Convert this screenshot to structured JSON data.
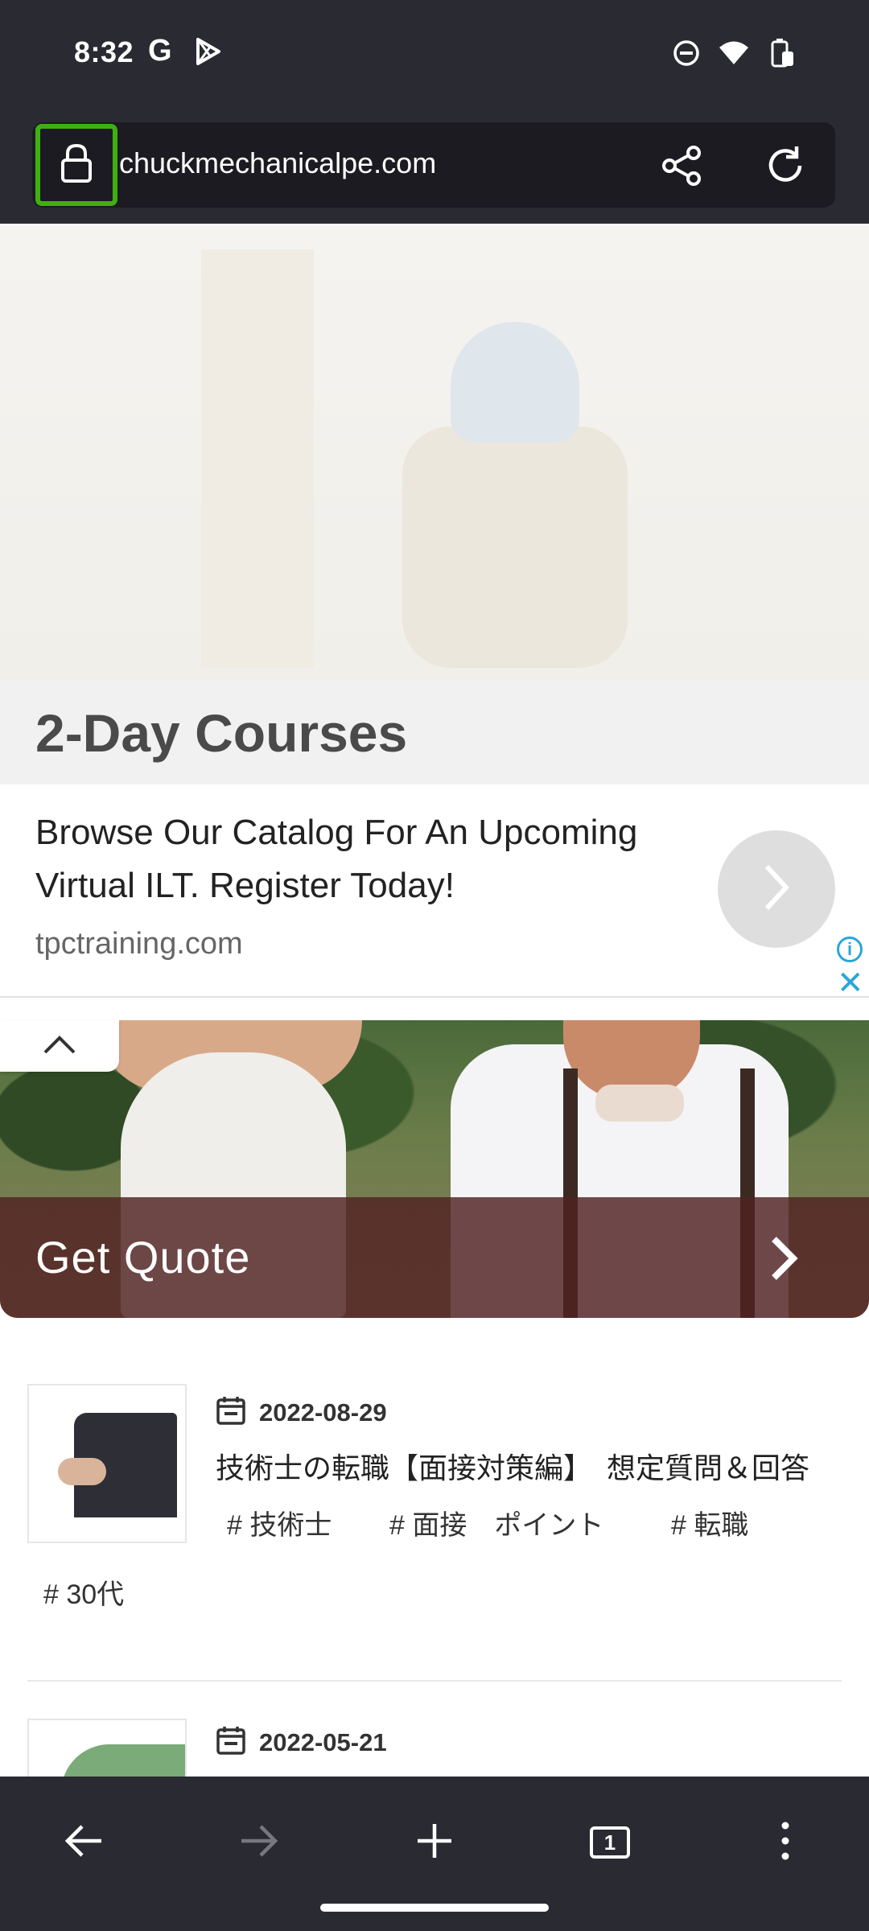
{
  "status_bar": {
    "time": "8:32",
    "google_icon": "G",
    "play_icon": "play-store-icon",
    "dnd_icon": "do-not-disturb-icon",
    "wifi_icon": "wifi-icon",
    "battery_icon": "battery-charging-icon"
  },
  "browser": {
    "url": "chuckmechanicalpe.com",
    "lock_icon": "lock-icon",
    "share_icon": "share-icon",
    "reload_icon": "reload-icon",
    "highlight_color": "#3fb012"
  },
  "ad": {
    "title": "2-Day Courses",
    "description": "Browse Our Catalog For An Upcoming Virtual ILT. Register Today!",
    "domain": "tpctraining.com",
    "info_glyph": "i",
    "close_glyph": "✕",
    "accent_color": "#2aa6d9"
  },
  "banner": {
    "cta": "Get Quote"
  },
  "articles": [
    {
      "date": "2022-08-29",
      "title": "技術士の転職【面接対策編】　想定質問＆回答",
      "tags": [
        "# 技術士",
        "# 面接　ポイント",
        "# 転職",
        "# 30代"
      ]
    },
    {
      "date": "2022-05-21"
    }
  ],
  "toolbar": {
    "back_icon": "back-arrow-icon",
    "forward_icon": "forward-arrow-icon",
    "new_tab_icon": "plus-icon",
    "tab_count": "1",
    "menu_icon": "overflow-menu-icon"
  }
}
